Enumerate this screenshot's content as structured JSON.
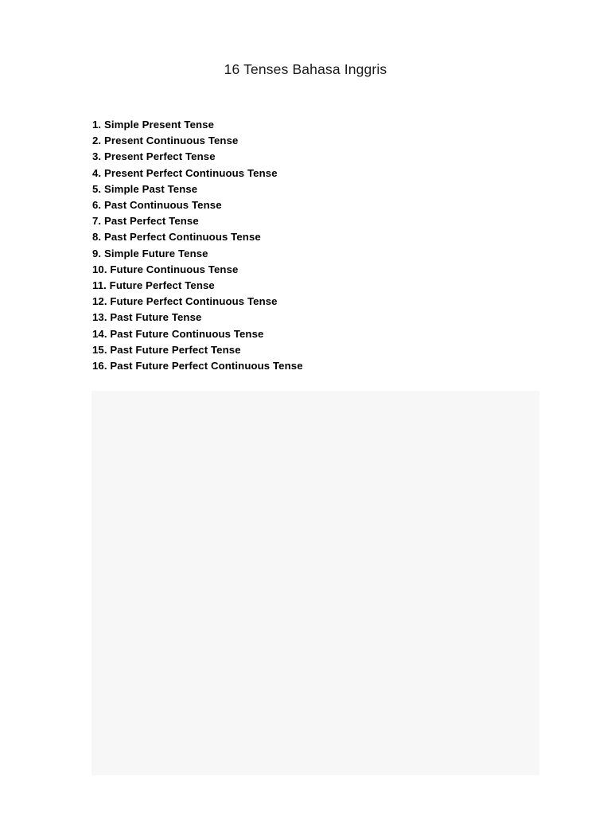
{
  "document": {
    "title": "16 Tenses Bahasa Inggris",
    "page_background": "#ffffff",
    "text_color": "#000000"
  },
  "tense_list": [
    {
      "number": "1.",
      "label": "Simple Present Tense"
    },
    {
      "number": "2.",
      "label": "Present Continuous Tense"
    },
    {
      "number": "3.",
      "label": "Present Perfect Tense"
    },
    {
      "number": "4.",
      "label": "Present Perfect Continuous Tense"
    },
    {
      "number": "5.",
      "label": "Simple Past Tense"
    },
    {
      "number": "6.",
      "label": "Past Continuous Tense"
    },
    {
      "number": "7.",
      "label": "Past Perfect Tense"
    },
    {
      "number": "8.",
      "label": "Past Perfect Continuous Tense"
    },
    {
      "number": "9.",
      "label": "Simple Future Tense"
    },
    {
      "number": "10.",
      "label": "Future Continuous Tense"
    },
    {
      "number": "11.",
      "label": "Future Perfect Tense"
    },
    {
      "number": "12.",
      "label": "Future Perfect Continuous Tense"
    },
    {
      "number": "13.",
      "label": "Past Future Tense"
    },
    {
      "number": "14.",
      "label": "Past Future Continuous Tense"
    },
    {
      "number": "15.",
      "label": "Past Future Perfect Tense"
    },
    {
      "number": "16.",
      "label": "Past Future Perfect Continuous Tense"
    }
  ],
  "placeholder": {
    "content": "",
    "fill_color": "#f7f7f7"
  }
}
